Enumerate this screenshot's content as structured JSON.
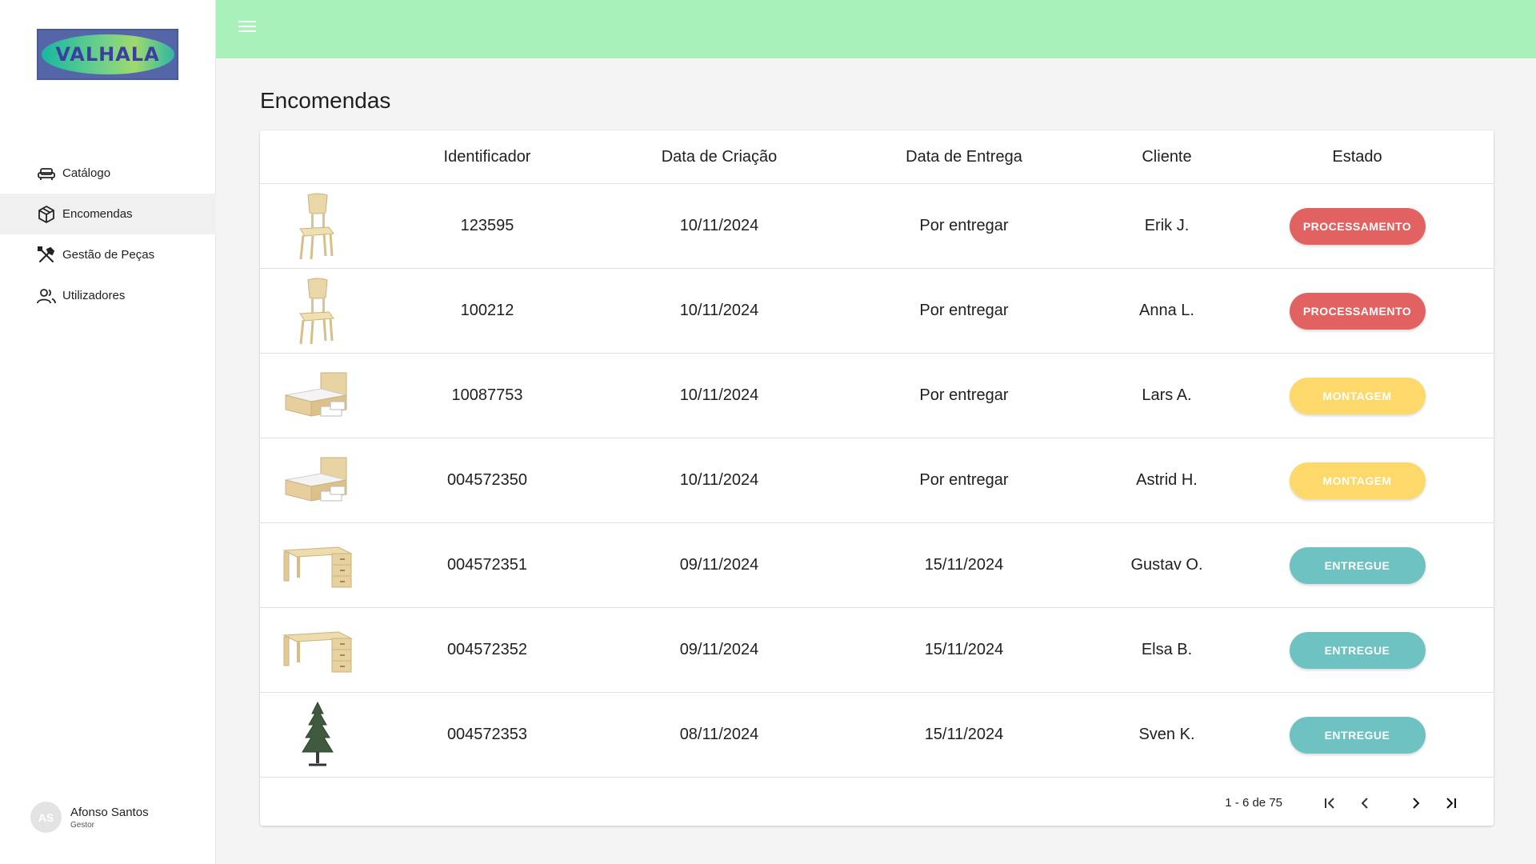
{
  "brand": {
    "logo_text": "VALHALA"
  },
  "sidebar": {
    "items": [
      {
        "label": "Catálogo",
        "icon": "sofa-icon",
        "active": false
      },
      {
        "label": "Encomendas",
        "icon": "box-icon",
        "active": true
      },
      {
        "label": "Gestão de Peças",
        "icon": "tools-icon",
        "active": false
      },
      {
        "label": "Utilizadores",
        "icon": "users-icon",
        "active": false
      }
    ],
    "user": {
      "initials": "AS",
      "name": "Afonso Santos",
      "role": "Gestor"
    }
  },
  "header": {
    "menu_icon": "hamburger-menu-icon"
  },
  "main": {
    "title": "Encomendas",
    "table": {
      "columns": [
        "Identificador",
        "Data de Criação",
        "Data de Entrega",
        "Cliente",
        "Estado"
      ],
      "rows": [
        {
          "image": "chair",
          "id": "123595",
          "created": "10/11/2024",
          "delivery": "Por entregar",
          "client": "Erik J.",
          "status": "PROCESSAMENTO"
        },
        {
          "image": "chair",
          "id": "100212",
          "created": "10/11/2024",
          "delivery": "Por entregar",
          "client": "Anna L.",
          "status": "PROCESSAMENTO"
        },
        {
          "image": "bed",
          "id": "10087753",
          "created": "10/11/2024",
          "delivery": "Por entregar",
          "client": "Lars A.",
          "status": "MONTAGEM"
        },
        {
          "image": "bed",
          "id": "004572350",
          "created": "10/11/2024",
          "delivery": "Por entregar",
          "client": "Astrid H.",
          "status": "MONTAGEM"
        },
        {
          "image": "desk",
          "id": "004572351",
          "created": "09/11/2024",
          "delivery": "15/11/2024",
          "client": "Gustav O.",
          "status": "ENTREGUE"
        },
        {
          "image": "desk",
          "id": "004572352",
          "created": "09/11/2024",
          "delivery": "15/11/2024",
          "client": "Elsa B.",
          "status": "ENTREGUE"
        },
        {
          "image": "tree",
          "id": "004572353",
          "created": "08/11/2024",
          "delivery": "15/11/2024",
          "client": "Sven K.",
          "status": "ENTREGUE"
        }
      ]
    },
    "pagination": {
      "range": "1 - 6 de 75"
    }
  },
  "colors": {
    "topbar": "#a9f1bb",
    "PROCESSAMENTO": "#e26262",
    "MONTAGEM": "#fdd86b",
    "ENTREGUE": "#6ec3c2"
  }
}
